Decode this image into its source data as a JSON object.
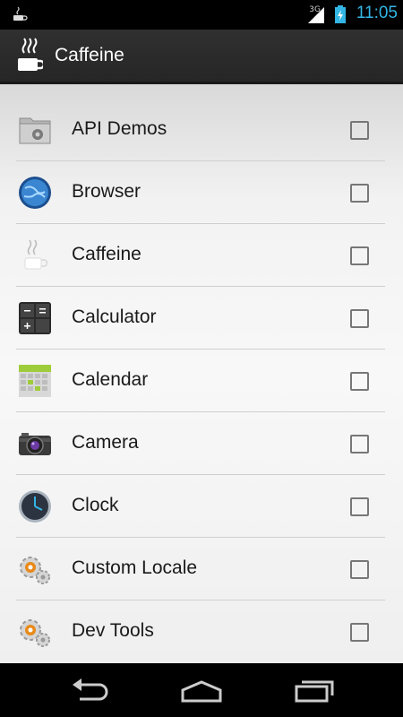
{
  "status_bar": {
    "time": "11:05",
    "network_type": "3G",
    "notification_icon": "coffee-cup-icon",
    "time_color": "#33b5e5"
  },
  "action_bar": {
    "app_icon": "coffee-cup-icon",
    "title": "Caffeine"
  },
  "apps": [
    {
      "label": "API Demos",
      "icon": "folder-gear-icon",
      "checked": false
    },
    {
      "label": "Browser",
      "icon": "globe-icon",
      "checked": false
    },
    {
      "label": "Caffeine",
      "icon": "coffee-cup-icon",
      "checked": false
    },
    {
      "label": "Calculator",
      "icon": "calculator-icon",
      "checked": false
    },
    {
      "label": "Calendar",
      "icon": "calendar-icon",
      "checked": false
    },
    {
      "label": "Camera",
      "icon": "camera-icon",
      "checked": false
    },
    {
      "label": "Clock",
      "icon": "clock-icon",
      "checked": false
    },
    {
      "label": "Custom Locale",
      "icon": "gear-icon",
      "checked": false
    },
    {
      "label": "Dev Tools",
      "icon": "gear-icon",
      "checked": false
    }
  ],
  "nav_bar": {
    "back": "back-icon",
    "home": "home-icon",
    "recents": "recents-icon"
  }
}
